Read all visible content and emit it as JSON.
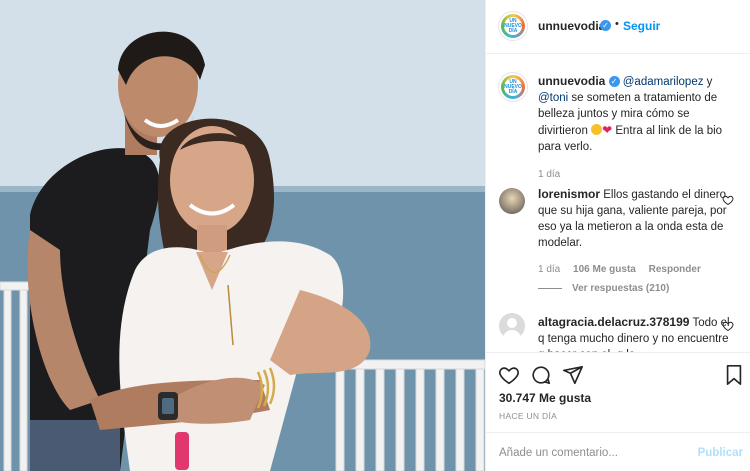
{
  "post": {
    "account": "unnuevodia",
    "avatar_text": "UN NUEVO DÍA",
    "follow_label": "Seguir",
    "caption": {
      "user": "unnuevodia",
      "mention1": "@adamarilopez",
      "and": " y ",
      "mention2": "@toni",
      "text": " se someten a tratamiento de belleza juntos y mira cómo se divirtieron ",
      "text2": " Entra al link de la bio para verlo.",
      "age": "1 día"
    },
    "comments": [
      {
        "user": "lorenismor",
        "text": "Ellos gastando el dinero que su hija gana, valiente pareja, por eso ya la metieron a la onda esta de modelar.",
        "age": "1 día",
        "likes": "106 Me gusta",
        "reply": "Responder",
        "view_replies": "Ver respuestas (210)"
      },
      {
        "user": "altagracia.delacruz.378199",
        "text": "Todo el q tenga mucho dinero y no encuentre q hacer con el, q lo"
      }
    ],
    "likes": "30.747 Me gusta",
    "date": "HACE UN DÍA",
    "add_comment_placeholder": "Añade un comentario...",
    "publish_label": "Publicar"
  },
  "icons": [
    "verified-icon",
    "heart-icon",
    "comment-icon",
    "share-icon",
    "bookmark-icon"
  ],
  "colors": {
    "link": "#0095f6",
    "mention": "#00376b",
    "muted": "#8e8e8e",
    "verified": "#3897f0"
  }
}
